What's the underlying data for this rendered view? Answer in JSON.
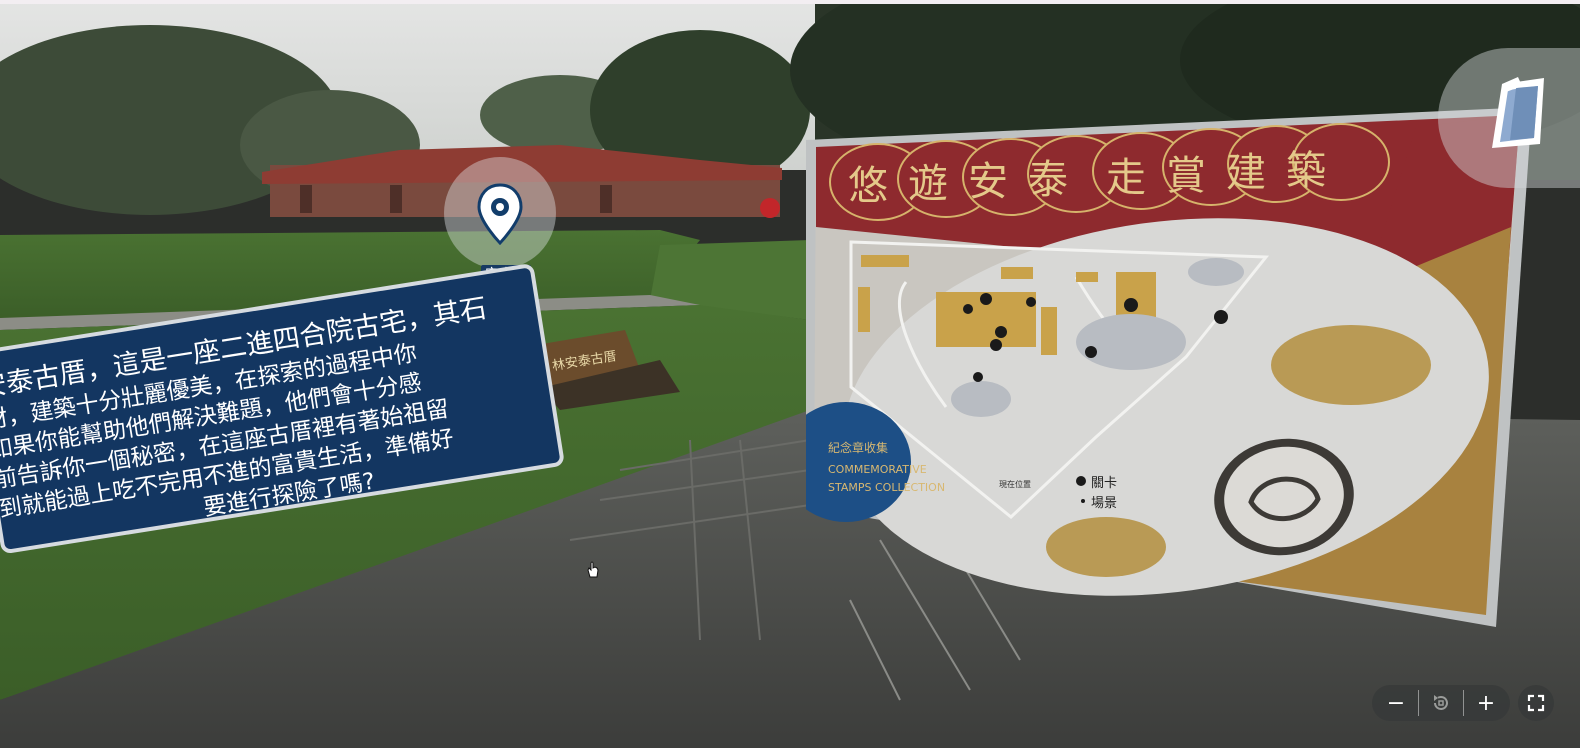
{
  "hotspot": {
    "label": "安泰堂",
    "icon": "location-pin-icon"
  },
  "info_panel": {
    "lines": [
      "安泰古厝，這是一座二進四合院古宅，其石",
      "材，建築十分壯麗優美，在探索的過程中你",
      "如果你能幫助他們解決難題，他們會十分感",
      "前告訴你一個秘密，在這座古厝裡有著始祖留",
      "到就能過上吃不完用不進的富貴生活，準備好",
      "要進行探險了嗎?"
    ]
  },
  "stone_sign": {
    "text": "林安泰古厝"
  },
  "map_card": {
    "title_chars": [
      "悠",
      "遊",
      "安",
      "泰",
      "走",
      "賞",
      "建",
      "築"
    ],
    "stamps_label_zh": "紀念章收集",
    "stamps_label_en_1": "COMMEMORATIVE",
    "stamps_label_en_2": "STAMPS COLLECTION",
    "legend_1": "關卡",
    "legend_2": "場景",
    "current_position": "現在位置",
    "colors": {
      "red": "#8e2a2e",
      "gold": "#b99a55",
      "grey": "#c5c3be"
    }
  },
  "hand_button": {
    "icon": "hand-icon"
  },
  "controls": {
    "zoom_out": "−",
    "reset_icon": "rotate-reset-icon",
    "zoom_in": "+",
    "fullscreen_icon": "fullscreen-icon"
  }
}
